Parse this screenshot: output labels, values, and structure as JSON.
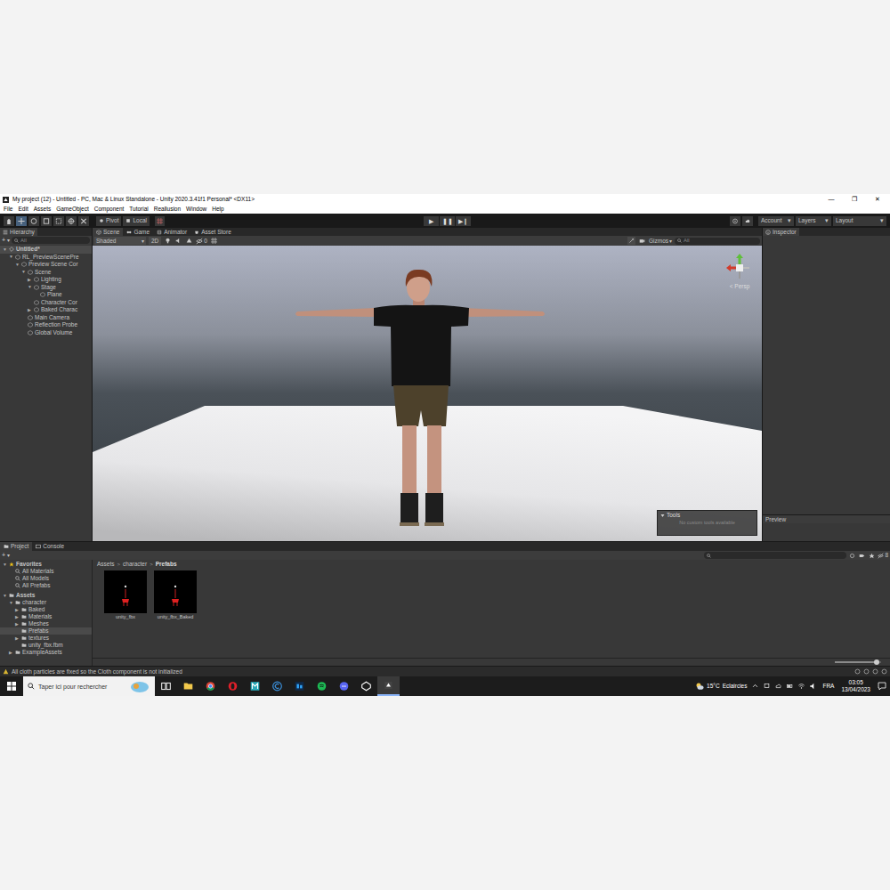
{
  "window": {
    "title": "My project (12) - Untitled - PC, Mac & Linux Standalone - Unity 2020.3.41f1 Personal* <DX11>",
    "controls": [
      "—",
      "❐",
      "✕"
    ]
  },
  "menu": [
    "File",
    "Edit",
    "Assets",
    "GameObject",
    "Component",
    "Tutorial",
    "Reallusion",
    "Window",
    "Help"
  ],
  "toolbar": {
    "pivot": "Pivot",
    "local": "Local",
    "playback": [
      "▶",
      "❚❚",
      "▶❙"
    ],
    "dropdown_arrow": "▾",
    "account": "Account",
    "layers": "Layers",
    "layout": "Layout"
  },
  "hierarchy": {
    "tab": "Hierarchy",
    "add": "+",
    "search": "All",
    "items": [
      {
        "label": "Untitled*",
        "depth": 0,
        "arrow": "▼",
        "selected": true
      },
      {
        "label": "RL_PreviewScenePre",
        "depth": 1,
        "arrow": "▼",
        "selected": false
      },
      {
        "label": "Preview Scene Cor",
        "depth": 2,
        "arrow": "▼",
        "selected": false
      },
      {
        "label": "Scene",
        "depth": 3,
        "arrow": "▼",
        "selected": false
      },
      {
        "label": "Lighting",
        "depth": 4,
        "arrow": "▶",
        "selected": false
      },
      {
        "label": "Stage",
        "depth": 4,
        "arrow": "▼",
        "selected": false
      },
      {
        "label": "Plane",
        "depth": 5,
        "arrow": "",
        "selected": false
      },
      {
        "label": "Character Cor",
        "depth": 4,
        "arrow": "",
        "selected": false
      },
      {
        "label": "Baked Charac",
        "depth": 4,
        "arrow": "▶",
        "selected": false
      },
      {
        "label": "Main Camera",
        "depth": 3,
        "arrow": "",
        "selected": false
      },
      {
        "label": "Reflection Probe",
        "depth": 3,
        "arrow": "",
        "selected": false
      },
      {
        "label": "Global Volume",
        "depth": 3,
        "arrow": "",
        "selected": false
      }
    ]
  },
  "scene": {
    "tabs": [
      {
        "label": "Scene",
        "selected": true
      },
      {
        "label": "Game",
        "selected": false
      },
      {
        "label": "Animator",
        "selected": false
      },
      {
        "label": "Asset Store",
        "selected": false
      }
    ],
    "shading": "Shaded",
    "mode_2d": "2D",
    "hidden_count": "0",
    "gizmos": "Gizmos",
    "search": "All",
    "projection": "< Persp",
    "tools": {
      "title": "Tools",
      "message": "No custom tools available"
    }
  },
  "inspector": {
    "tab": "Inspector",
    "preview": "Preview"
  },
  "project": {
    "tabs": [
      {
        "label": "Project",
        "selected": true
      },
      {
        "label": "Console",
        "selected": false
      }
    ],
    "add": "+",
    "count": "8",
    "tree": [
      {
        "label": "Favorites",
        "depth": 0,
        "arrow": "▼",
        "kind": "favorites",
        "selected": false
      },
      {
        "label": "All Materials",
        "depth": 1,
        "arrow": "",
        "kind": "search",
        "selected": false
      },
      {
        "label": "All Models",
        "depth": 1,
        "arrow": "",
        "kind": "search",
        "selected": false
      },
      {
        "label": "All Prefabs",
        "depth": 1,
        "arrow": "",
        "kind": "search",
        "selected": false
      },
      {
        "label": "Assets",
        "depth": 0,
        "arrow": "▼",
        "kind": "folder",
        "selected": false
      },
      {
        "label": "character",
        "depth": 1,
        "arrow": "▼",
        "kind": "folder",
        "selected": false
      },
      {
        "label": "Baked",
        "depth": 2,
        "arrow": "▶",
        "kind": "folder",
        "selected": false
      },
      {
        "label": "Materials",
        "depth": 2,
        "arrow": "▶",
        "kind": "folder",
        "selected": false
      },
      {
        "label": "Meshes",
        "depth": 2,
        "arrow": "▶",
        "kind": "folder",
        "selected": false
      },
      {
        "label": "Prefabs",
        "depth": 2,
        "arrow": "",
        "kind": "folder",
        "selected": true
      },
      {
        "label": "textures",
        "depth": 2,
        "arrow": "▶",
        "kind": "folder",
        "selected": false
      },
      {
        "label": "unity_fbx.fbm",
        "depth": 2,
        "arrow": "",
        "kind": "folder",
        "selected": false
      },
      {
        "label": "ExampleAssets",
        "depth": 1,
        "arrow": "▶",
        "kind": "folder",
        "selected": false
      }
    ],
    "breadcrumb": [
      "Assets",
      "character",
      "Prefabs"
    ],
    "separator": ">",
    "assets": [
      {
        "label": "unity_fbx"
      },
      {
        "label": "unity_fbx_Baked"
      }
    ],
    "icon_size": {
      "level": 0.9
    }
  },
  "status_bar": {
    "message": "All cloth particles are fixed so the Cloth component is not initialized"
  },
  "taskbar": {
    "search": "Taper ici pour rechercher",
    "temperature": "15°C",
    "weather": "Eclaircies",
    "language": "FRA",
    "time": "03:05",
    "date": "13/04/2023"
  }
}
